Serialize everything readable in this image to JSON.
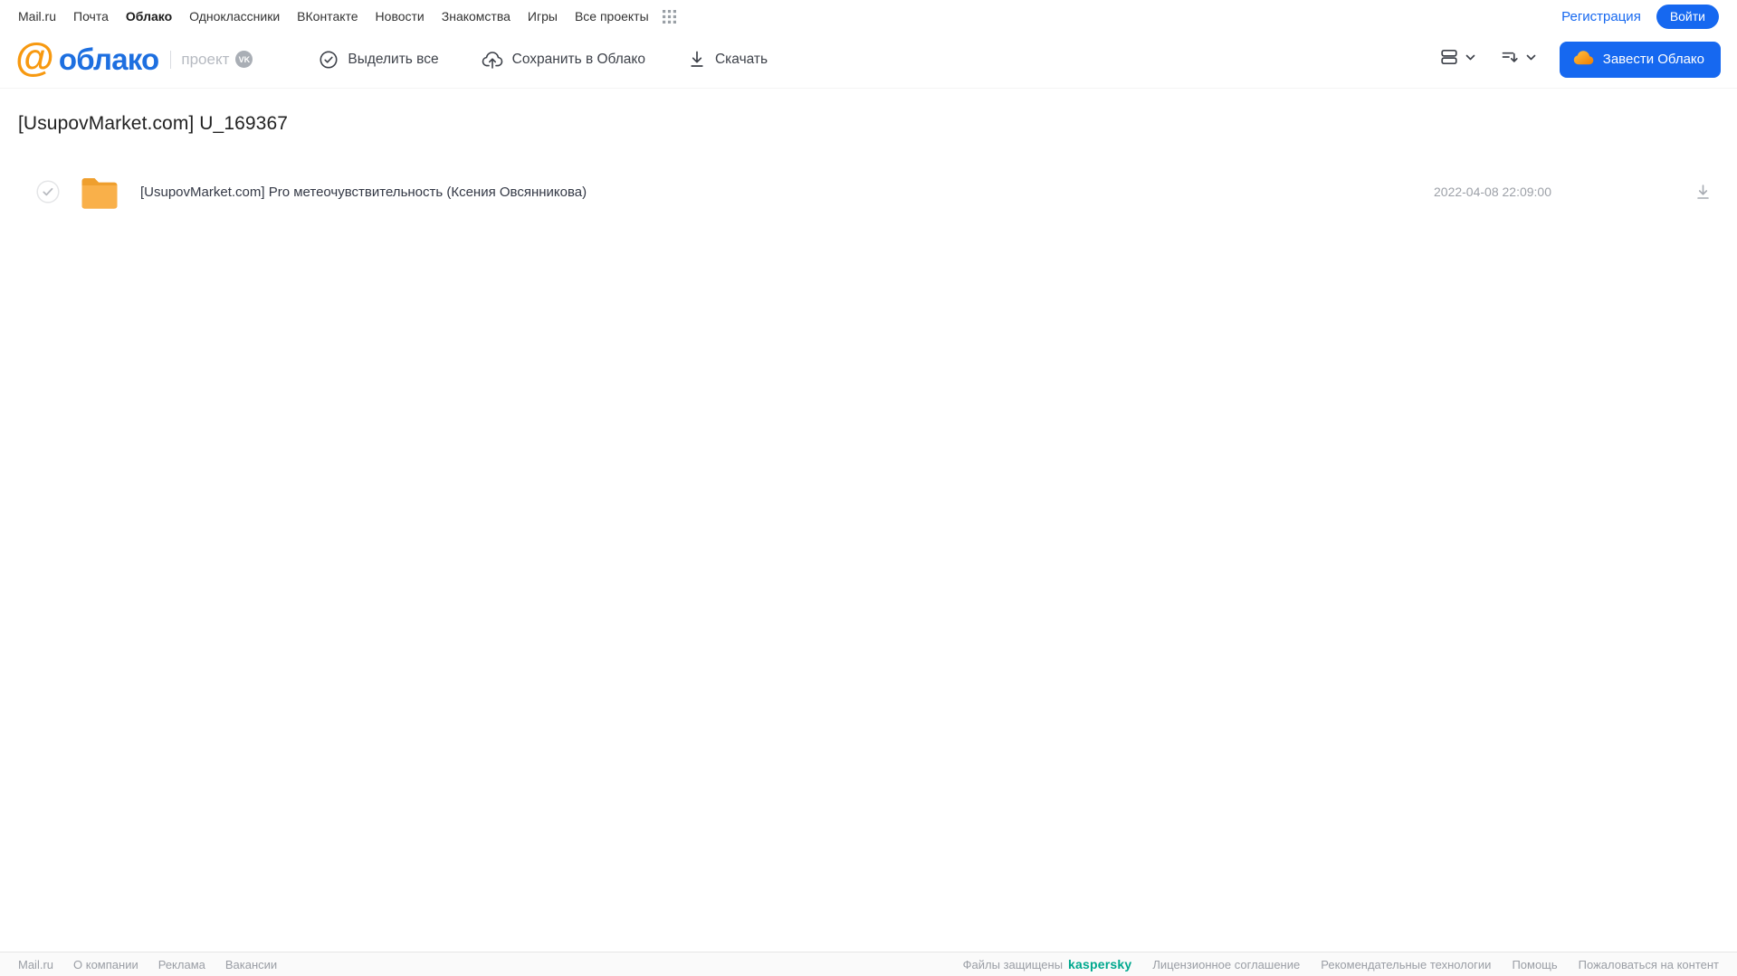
{
  "portal_nav": {
    "items": [
      {
        "label": "Mail.ru"
      },
      {
        "label": "Почта"
      },
      {
        "label": "Облако"
      },
      {
        "label": "Одноклассники"
      },
      {
        "label": "ВКонтакте"
      },
      {
        "label": "Новости"
      },
      {
        "label": "Знакомства"
      },
      {
        "label": "Игры"
      },
      {
        "label": "Все проекты"
      }
    ],
    "register_label": "Регистрация",
    "login_label": "Войти"
  },
  "header": {
    "logo": {
      "at_symbol": "@",
      "brand": "облако",
      "project_label": "проект",
      "vk_badge": "VK"
    },
    "actions": {
      "select_all": "Выделить все",
      "save_to_cloud": "Сохранить в Облако",
      "download": "Скачать"
    },
    "get_cloud_button": "Завести Облако"
  },
  "main": {
    "page_title": "[UsupovMarket.com] U_169367",
    "files": [
      {
        "type": "folder",
        "name": "[UsupovMarket.com] Pro метеочувствительность (Ксения Овсянникова)",
        "modified": "2022-04-08 22:09:00"
      }
    ]
  },
  "footer": {
    "left_links": [
      {
        "label": "Mail.ru"
      },
      {
        "label": "О компании"
      },
      {
        "label": "Реклама"
      },
      {
        "label": "Вакансии"
      }
    ],
    "protected_by": "Файлы защищены",
    "kaspersky": "kaspersky",
    "right_links": [
      {
        "label": "Лицензионное соглашение"
      },
      {
        "label": "Рекомендательные технологии"
      },
      {
        "label": "Помощь"
      },
      {
        "label": "Пожаловаться на контент"
      }
    ]
  },
  "colors": {
    "accent_blue": "#1668f0",
    "logo_blue": "#1d6fe0",
    "logo_orange": "#f79910",
    "folder_orange": "#f9ad38",
    "kaspersky_green": "#00a88e",
    "muted_gray": "#9a9ea5"
  }
}
